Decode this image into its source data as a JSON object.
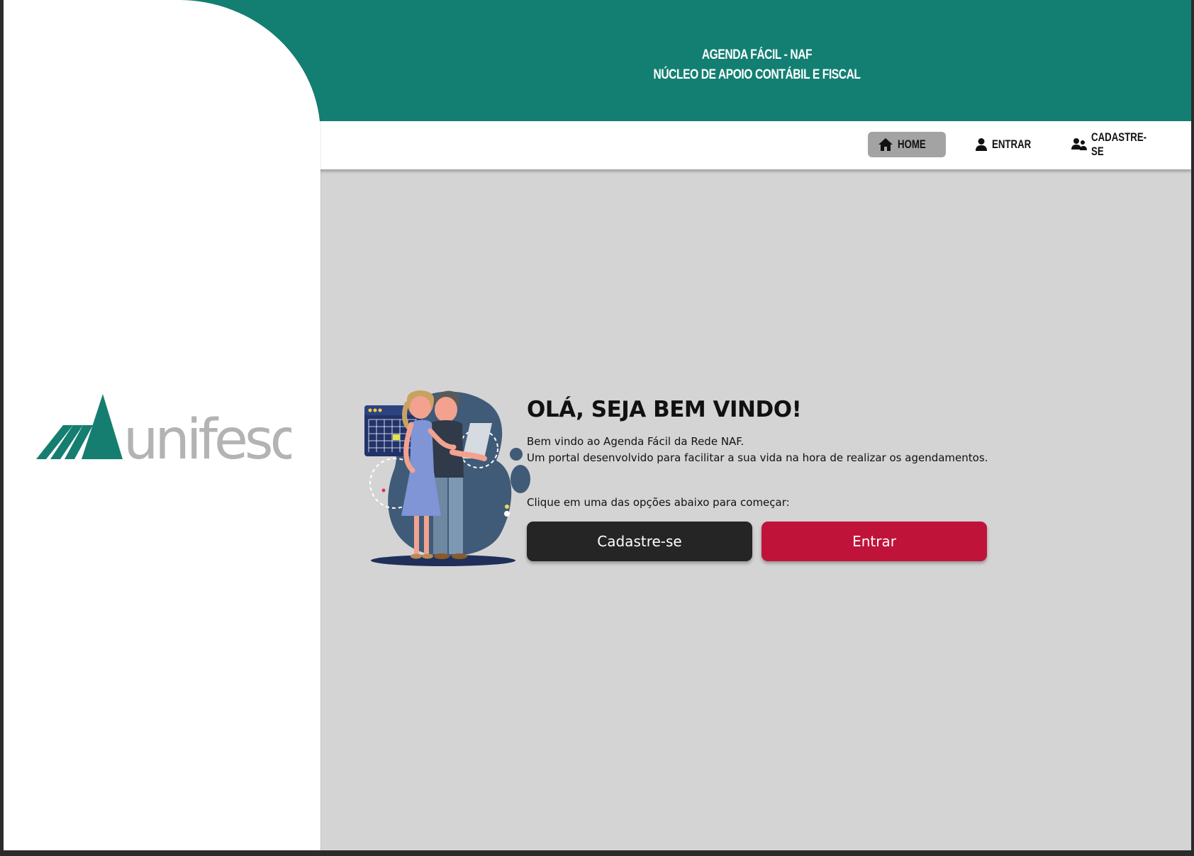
{
  "header": {
    "title_line1": "AGENDA FÁCIL - NAF",
    "title_line2": "NÚCLEO DE APOIO CONTÁBIL E FISCAL"
  },
  "nav": {
    "items": [
      {
        "label": "HOME",
        "icon": "home-icon",
        "active": true
      },
      {
        "label": "ENTRAR",
        "icon": "user-icon",
        "active": false
      },
      {
        "label": "CADASTRE-SE",
        "icon": "users-icon",
        "active": false
      }
    ]
  },
  "sidebar": {
    "logo_text": "unifeso"
  },
  "main": {
    "heading": "OLÁ, SEJA BEM VINDO!",
    "line1": "Bem vindo ao Agenda Fácil da Rede NAF.",
    "line2": "Um portal desenvolvido para facilitar a sua vida na hora de realizar os agendamentos.",
    "prompt": "Clique em uma das opções abaixo para começar:",
    "signup_label": "Cadastre-se",
    "login_label": "Entrar"
  },
  "colors": {
    "brand": "#137f72",
    "background": "#d4d4d4",
    "dark_button": "#252525",
    "accent_button": "#c0133a",
    "nav_active": "#a3a3a3"
  }
}
